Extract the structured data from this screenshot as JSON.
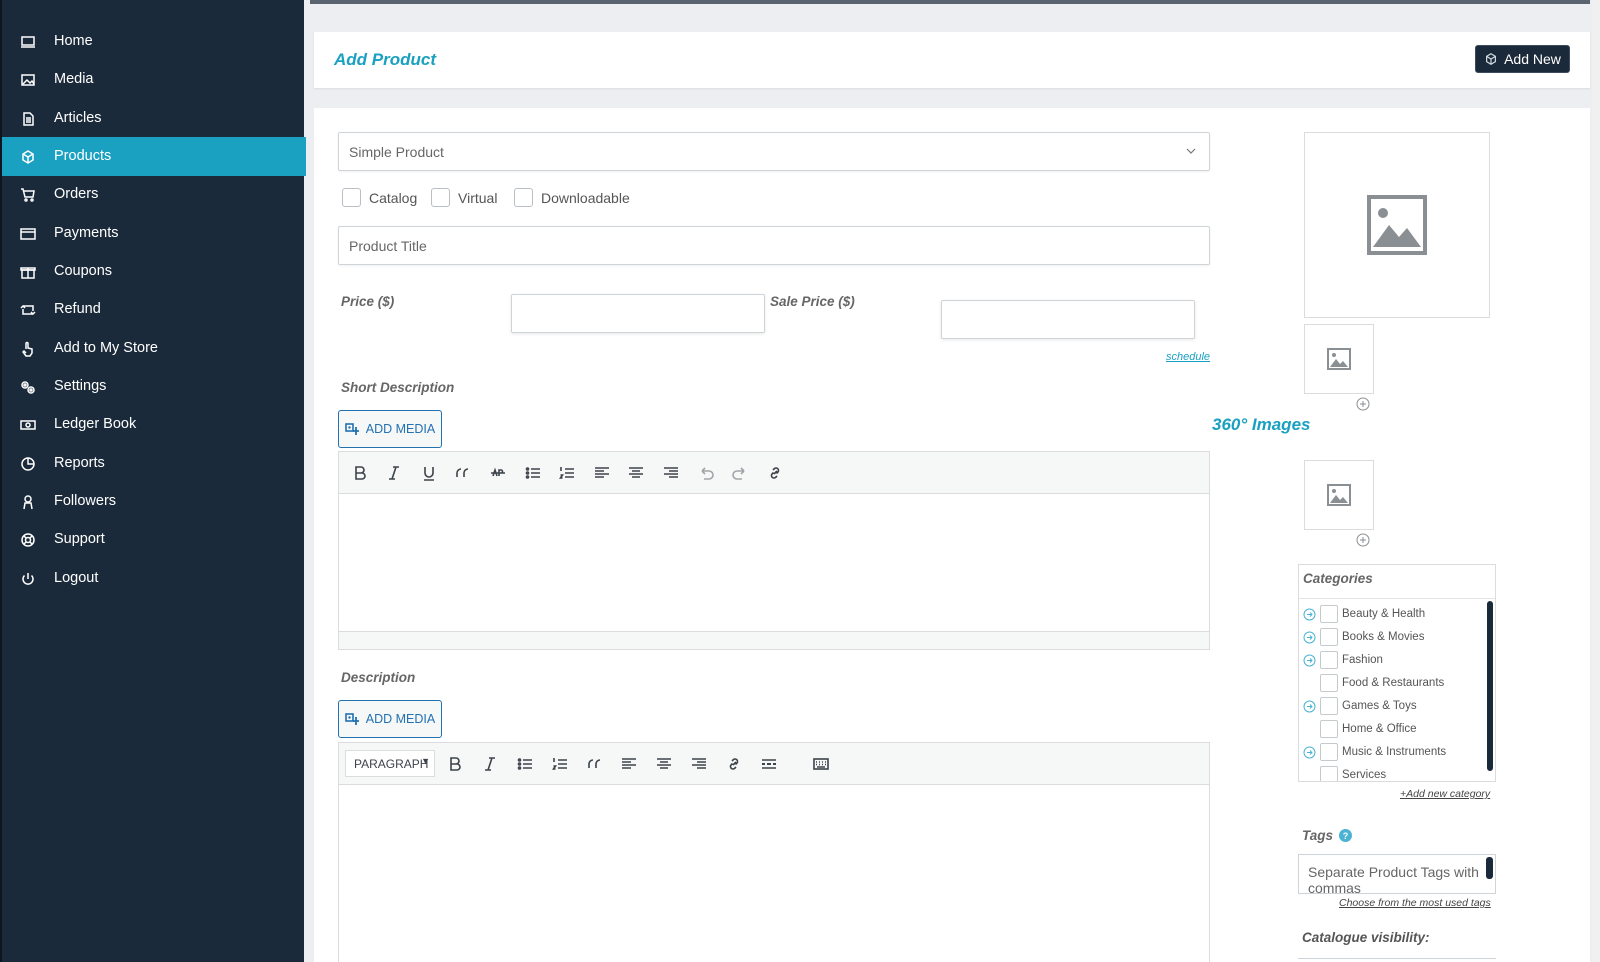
{
  "sidebar": {
    "items": [
      {
        "label": "Home",
        "icon": "monitor-icon"
      },
      {
        "label": "Media",
        "icon": "image-icon"
      },
      {
        "label": "Articles",
        "icon": "document-icon"
      },
      {
        "label": "Products",
        "icon": "cube-icon",
        "active": true
      },
      {
        "label": "Orders",
        "icon": "cart-icon"
      },
      {
        "label": "Payments",
        "icon": "credit-card-icon"
      },
      {
        "label": "Coupons",
        "icon": "gift-icon"
      },
      {
        "label": "Refund",
        "icon": "refund-icon"
      },
      {
        "label": "Add to My Store",
        "icon": "hand-pointer-icon"
      },
      {
        "label": "Settings",
        "icon": "gears-icon"
      },
      {
        "label": "Ledger Book",
        "icon": "money-icon"
      },
      {
        "label": "Reports",
        "icon": "pie-chart-icon"
      },
      {
        "label": "Followers",
        "icon": "user-icon"
      },
      {
        "label": "Support",
        "icon": "lifebuoy-icon"
      },
      {
        "label": "Logout",
        "icon": "power-icon"
      }
    ]
  },
  "header": {
    "title": "Add Product",
    "add_new_label": "Add New"
  },
  "form": {
    "product_type": "Simple Product",
    "checkboxes": [
      "Catalog",
      "Virtual",
      "Downloadable"
    ],
    "title_placeholder": "Product Title",
    "price_label": "Price ($)",
    "sale_price_label": "Sale Price ($)",
    "schedule_link": "schedule",
    "short_description_label": "Short Description",
    "description_label": "Description",
    "add_media_label": "ADD MEDIA",
    "paragraph_label": "PARAGRAPH"
  },
  "right": {
    "images_360_title": "360° Images",
    "categories_title": "Categories",
    "categories": [
      {
        "label": "Beauty & Health",
        "has_children": true
      },
      {
        "label": "Books & Movies",
        "has_children": true
      },
      {
        "label": "Fashion",
        "has_children": true
      },
      {
        "label": "Food & Restaurants",
        "has_children": false
      },
      {
        "label": "Games & Toys",
        "has_children": true
      },
      {
        "label": "Home & Office",
        "has_children": false
      },
      {
        "label": "Music & Instruments",
        "has_children": true
      },
      {
        "label": "Services",
        "has_children": false
      }
    ],
    "add_category_link": "+Add new category",
    "tags_label": "Tags",
    "tags_placeholder": "Separate Product Tags with commas",
    "choose_tags_link": "Choose from the most used tags",
    "visibility_label": "Catalogue visibility:"
  },
  "colors": {
    "sidebar_bg": "#1b2a3a",
    "accent": "#1aa0c1",
    "wp_blue": "#2271b1"
  }
}
